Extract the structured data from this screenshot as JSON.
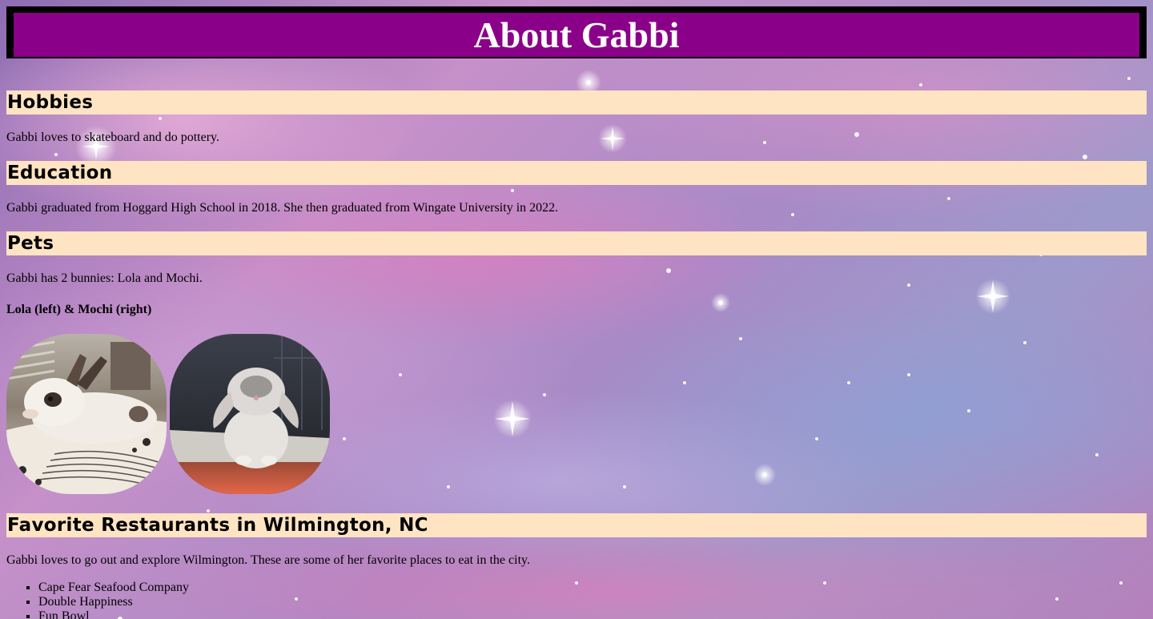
{
  "page": {
    "title": "About Gabbi"
  },
  "sections": {
    "hobbies": {
      "heading": "Hobbies",
      "text": "Gabbi loves to skateboard and do pottery."
    },
    "education": {
      "heading": "Education",
      "text": "Gabbi graduated from Hoggard High School in 2018. She then graduated from Wingate University in 2022."
    },
    "pets": {
      "heading": "Pets",
      "text": "Gabbi has 2 bunnies: Lola and Mochi.",
      "caption": "Lola (left) & Mochi (right)"
    },
    "restaurants": {
      "heading": "Favorite Restaurants in Wilmington, NC",
      "text": "Gabbi loves to go out and explore Wilmington. These are some of her favorite places to eat in the city.",
      "items": [
        "Cape Fear Seafood Company",
        "Double Happiness",
        "Fun Bowl"
      ]
    }
  },
  "colors": {
    "banner_border": "#000000",
    "banner_fill": "#8b0089",
    "heading_background": "#ffe4c4"
  }
}
